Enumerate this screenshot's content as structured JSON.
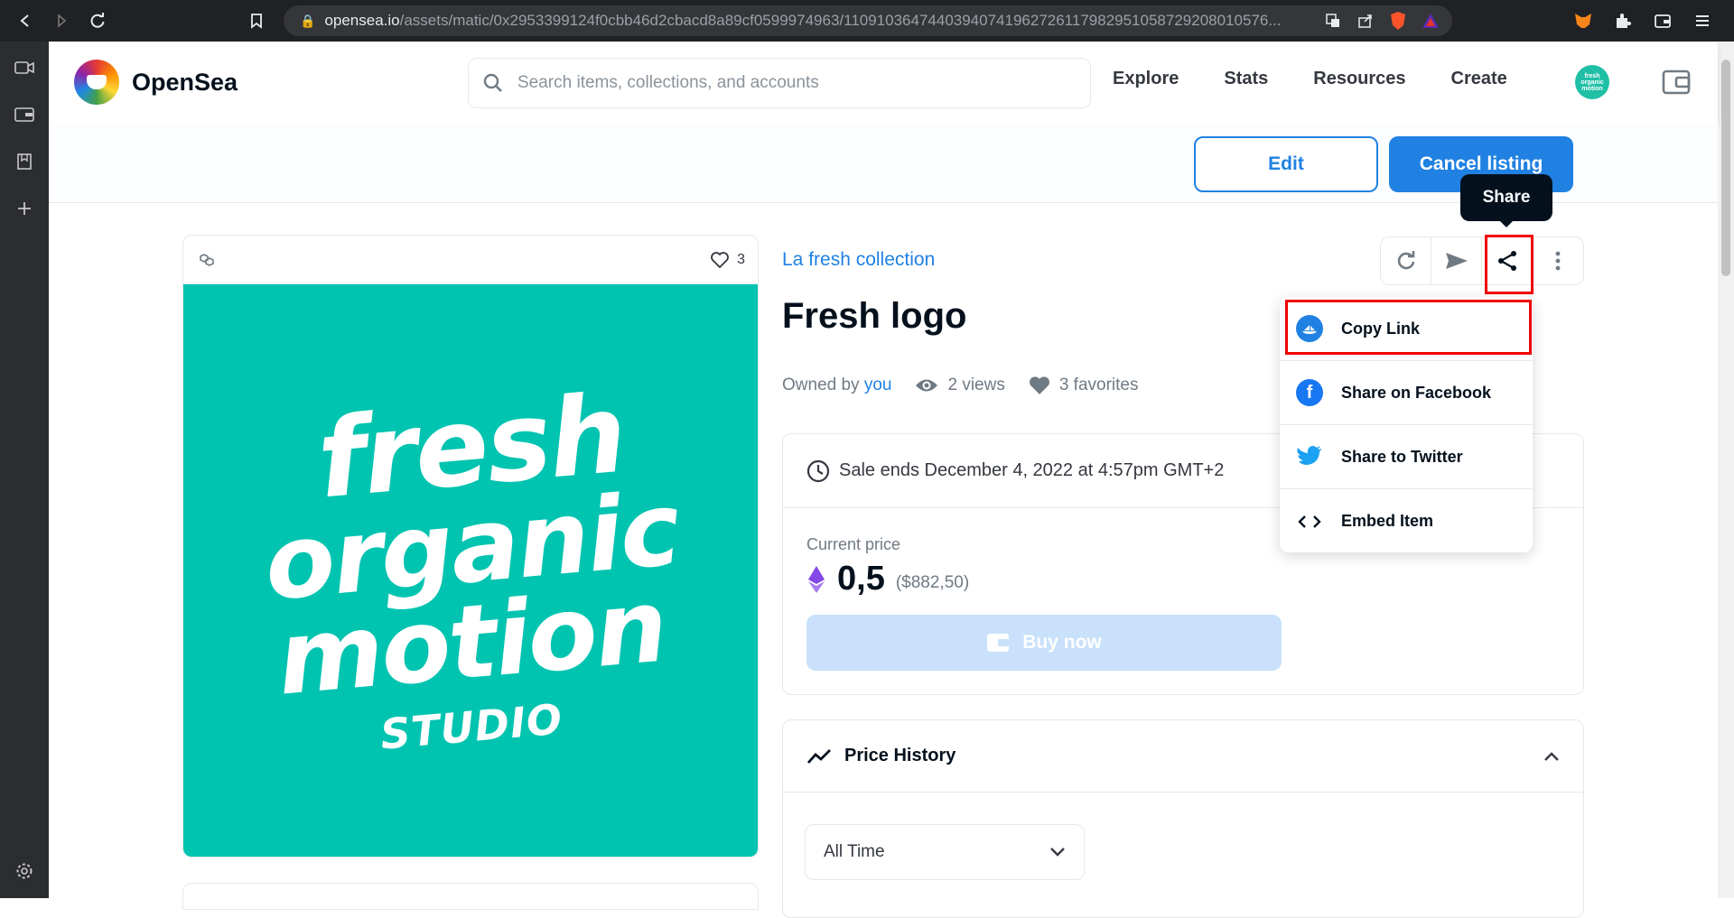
{
  "browser": {
    "url_host": "opensea.io",
    "url_path": "/assets/matic/0x2953399124f0cbb46d2cbacd8a89cf0599974963/11091036474403940741962726117982951058729208010576..."
  },
  "header": {
    "logo_text": "OpenSea",
    "search_placeholder": "Search items, collections, and accounts",
    "nav": {
      "explore": "Explore",
      "stats": "Stats",
      "resources": "Resources",
      "create": "Create"
    },
    "avatar_text": "fresh organic motion"
  },
  "actions": {
    "edit": "Edit",
    "cancel_listing": "Cancel listing"
  },
  "tooltip": "Share",
  "card": {
    "favorites_count": "3",
    "image_lines": [
      "fresh",
      "organic",
      "motion",
      "STUDIO"
    ]
  },
  "asset": {
    "collection": "La fresh collection",
    "title": "Fresh logo",
    "owned_by_label": "Owned by",
    "owner": "you",
    "views": "2 views",
    "favorites": "3 favorites"
  },
  "sale": {
    "ends": "Sale ends December 4, 2022 at 4:57pm GMT+2",
    "current_price_label": "Current price",
    "price": "0,5",
    "price_usd": "($882,50)",
    "buy_now": "Buy now"
  },
  "price_history": {
    "title": "Price History",
    "range": "All Time"
  },
  "share_menu": {
    "items": [
      "Copy Link",
      "Share on Facebook",
      "Share to Twitter",
      "Embed Item"
    ]
  },
  "colors": {
    "accent": "#2081e2",
    "image_bg": "#00c4b0",
    "highlight": "#ee0000"
  }
}
